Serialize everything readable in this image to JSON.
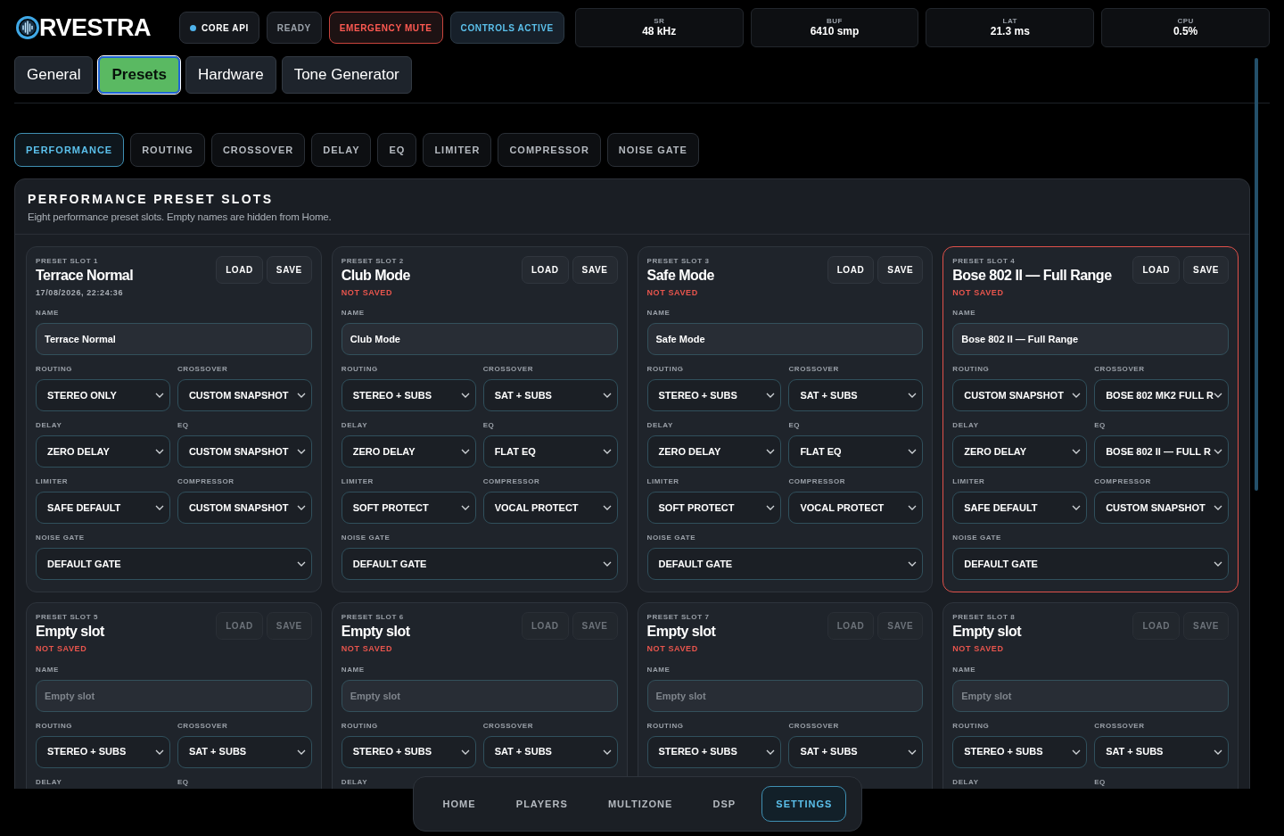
{
  "brand": {
    "name": "RVESTRA"
  },
  "status_pills": [
    {
      "text": "CORE API",
      "kind": "dot"
    },
    {
      "text": "READY",
      "kind": "plain"
    },
    {
      "text": "EMERGENCY MUTE",
      "kind": "danger"
    },
    {
      "text": "CONTROLS ACTIVE",
      "kind": "info"
    }
  ],
  "stats": [
    {
      "label": "SR",
      "value": "48 kHz"
    },
    {
      "label": "BUF",
      "value": "6410 smp"
    },
    {
      "label": "LAT",
      "value": "21.3 ms"
    },
    {
      "label": "CPU",
      "value": "0.5%"
    }
  ],
  "tabs": [
    {
      "label": "General",
      "selected": false
    },
    {
      "label": "Presets",
      "selected": true
    },
    {
      "label": "Hardware",
      "selected": false
    },
    {
      "label": "Tone Generator",
      "selected": false
    }
  ],
  "subtabs": [
    {
      "label": "PERFORMANCE",
      "selected": true
    },
    {
      "label": "ROUTING",
      "selected": false
    },
    {
      "label": "CROSSOVER",
      "selected": false
    },
    {
      "label": "DELAY",
      "selected": false
    },
    {
      "label": "EQ",
      "selected": false
    },
    {
      "label": "LIMITER",
      "selected": false
    },
    {
      "label": "COMPRESSOR",
      "selected": false
    },
    {
      "label": "NOISE GATE",
      "selected": false
    }
  ],
  "panel": {
    "title": "PERFORMANCE PRESET SLOTS",
    "subtitle": "Eight performance preset slots. Empty names are hidden from Home."
  },
  "slots": [
    {
      "slot_label": "PRESET SLOT 1",
      "title": "Terrace Normal",
      "status": {
        "kind": "saved",
        "text": "17/08/2026, 22:24:36"
      },
      "selected": false,
      "buttons": [
        {
          "label": "LOAD",
          "disabled": false
        },
        {
          "label": "SAVE",
          "disabled": false
        }
      ],
      "name_field": {
        "label": "NAME",
        "value": "Terrace Normal"
      },
      "selects": [
        {
          "label": "ROUTING",
          "value": "STEREO ONLY",
          "wide": false
        },
        {
          "label": "CROSSOVER",
          "value": "CUSTOM SNAPSHOT",
          "wide": false
        },
        {
          "label": "DELAY",
          "value": "ZERO DELAY",
          "wide": false
        },
        {
          "label": "EQ",
          "value": "CUSTOM SNAPSHOT",
          "wide": false
        },
        {
          "label": "LIMITER",
          "value": "SAFE DEFAULT",
          "wide": false
        },
        {
          "label": "COMPRESSOR",
          "value": "CUSTOM SNAPSHOT",
          "wide": false
        },
        {
          "label": "NOISE GATE",
          "value": "DEFAULT GATE",
          "wide": true
        }
      ]
    },
    {
      "slot_label": "PRESET SLOT 2",
      "title": "Club Mode",
      "status": {
        "kind": "unsaved",
        "text": "NOT SAVED"
      },
      "selected": false,
      "buttons": [
        {
          "label": "LOAD",
          "disabled": false
        },
        {
          "label": "SAVE",
          "disabled": false
        }
      ],
      "name_field": {
        "label": "NAME",
        "value": "Club Mode"
      },
      "selects": [
        {
          "label": "ROUTING",
          "value": "STEREO + SUBS",
          "wide": false
        },
        {
          "label": "CROSSOVER",
          "value": "SAT + SUBS",
          "wide": false
        },
        {
          "label": "DELAY",
          "value": "ZERO DELAY",
          "wide": false
        },
        {
          "label": "EQ",
          "value": "FLAT EQ",
          "wide": false
        },
        {
          "label": "LIMITER",
          "value": "SOFT PROTECT",
          "wide": false
        },
        {
          "label": "COMPRESSOR",
          "value": "VOCAL PROTECT",
          "wide": false
        },
        {
          "label": "NOISE GATE",
          "value": "DEFAULT GATE",
          "wide": true
        }
      ]
    },
    {
      "slot_label": "PRESET SLOT 3",
      "title": "Safe Mode",
      "status": {
        "kind": "unsaved",
        "text": "NOT SAVED"
      },
      "selected": false,
      "buttons": [
        {
          "label": "LOAD",
          "disabled": false
        },
        {
          "label": "SAVE",
          "disabled": false
        }
      ],
      "name_field": {
        "label": "NAME",
        "value": "Safe Mode"
      },
      "selects": [
        {
          "label": "ROUTING",
          "value": "STEREO + SUBS",
          "wide": false
        },
        {
          "label": "CROSSOVER",
          "value": "SAT + SUBS",
          "wide": false
        },
        {
          "label": "DELAY",
          "value": "ZERO DELAY",
          "wide": false
        },
        {
          "label": "EQ",
          "value": "FLAT EQ",
          "wide": false
        },
        {
          "label": "LIMITER",
          "value": "SOFT PROTECT",
          "wide": false
        },
        {
          "label": "COMPRESSOR",
          "value": "VOCAL PROTECT",
          "wide": false
        },
        {
          "label": "NOISE GATE",
          "value": "DEFAULT GATE",
          "wide": true
        }
      ]
    },
    {
      "slot_label": "PRESET SLOT 4",
      "title": "Bose 802 II — Full Range",
      "status": {
        "kind": "unsaved",
        "text": "NOT SAVED"
      },
      "selected": true,
      "buttons": [
        {
          "label": "LOAD",
          "disabled": false
        },
        {
          "label": "SAVE",
          "disabled": false
        }
      ],
      "name_field": {
        "label": "NAME",
        "value": "Bose 802 II — Full Range"
      },
      "selects": [
        {
          "label": "ROUTING",
          "value": "CUSTOM SNAPSHOT",
          "wide": false
        },
        {
          "label": "CROSSOVER",
          "value": "BOSE 802 MK2 FULL R",
          "wide": false
        },
        {
          "label": "DELAY",
          "value": "ZERO DELAY",
          "wide": false
        },
        {
          "label": "EQ",
          "value": "BOSE 802 II — FULL R",
          "wide": false
        },
        {
          "label": "LIMITER",
          "value": "SAFE DEFAULT",
          "wide": false
        },
        {
          "label": "COMPRESSOR",
          "value": "CUSTOM SNAPSHOT",
          "wide": false
        },
        {
          "label": "NOISE GATE",
          "value": "DEFAULT GATE",
          "wide": true
        }
      ]
    },
    {
      "slot_label": "PRESET SLOT 5",
      "title": "Empty slot",
      "status": {
        "kind": "unsaved",
        "text": "NOT SAVED"
      },
      "selected": false,
      "buttons": [
        {
          "label": "LOAD",
          "disabled": true
        },
        {
          "label": "SAVE",
          "disabled": true
        }
      ],
      "name_field": {
        "label": "NAME",
        "placeholder": "Empty slot"
      },
      "selects": [
        {
          "label": "ROUTING",
          "value": "STEREO + SUBS",
          "wide": false
        },
        {
          "label": "CROSSOVER",
          "value": "SAT + SUBS",
          "wide": false
        },
        {
          "label": "DELAY",
          "wide": false
        },
        {
          "label": "EQ",
          "wide": false
        }
      ]
    },
    {
      "slot_label": "PRESET SLOT 6",
      "title": "Empty slot",
      "status": {
        "kind": "unsaved",
        "text": "NOT SAVED"
      },
      "selected": false,
      "buttons": [
        {
          "label": "LOAD",
          "disabled": true
        },
        {
          "label": "SAVE",
          "disabled": true
        }
      ],
      "name_field": {
        "label": "NAME",
        "placeholder": "Empty slot"
      },
      "selects": [
        {
          "label": "ROUTING",
          "value": "STEREO + SUBS",
          "wide": false
        },
        {
          "label": "CROSSOVER",
          "value": "SAT + SUBS",
          "wide": false
        },
        {
          "label": "DELAY",
          "wide": false
        }
      ]
    },
    {
      "slot_label": "PRESET SLOT 7",
      "title": "Empty slot",
      "status": {
        "kind": "unsaved",
        "text": "NOT SAVED"
      },
      "selected": false,
      "buttons": [
        {
          "label": "LOAD",
          "disabled": true
        },
        {
          "label": "SAVE",
          "disabled": true
        }
      ],
      "name_field": {
        "label": "NAME",
        "placeholder": "Empty slot"
      },
      "selects": [
        {
          "label": "ROUTING",
          "value": "STEREO + SUBS",
          "wide": false
        },
        {
          "label": "CROSSOVER",
          "value": "SAT + SUBS",
          "wide": false
        }
      ]
    },
    {
      "slot_label": "PRESET SLOT 8",
      "title": "Empty slot",
      "status": {
        "kind": "unsaved",
        "text": "NOT SAVED"
      },
      "selected": false,
      "buttons": [
        {
          "label": "LOAD",
          "disabled": true
        },
        {
          "label": "SAVE",
          "disabled": true
        }
      ],
      "name_field": {
        "label": "NAME",
        "placeholder": "Empty slot"
      },
      "selects": [
        {
          "label": "ROUTING",
          "value": "STEREO + SUBS",
          "wide": false
        },
        {
          "label": "CROSSOVER",
          "value": "SAT + SUBS",
          "wide": false
        },
        {
          "label": "DELAY",
          "wide": false
        },
        {
          "label": "EQ",
          "wide": false
        }
      ]
    }
  ],
  "bottom_nav": [
    {
      "label": "HOME",
      "selected": false
    },
    {
      "label": "PLAYERS",
      "selected": false
    },
    {
      "label": "MULTIZONE",
      "selected": false
    },
    {
      "label": "DSP",
      "selected": false
    },
    {
      "label": "SETTINGS",
      "selected": true
    }
  ]
}
